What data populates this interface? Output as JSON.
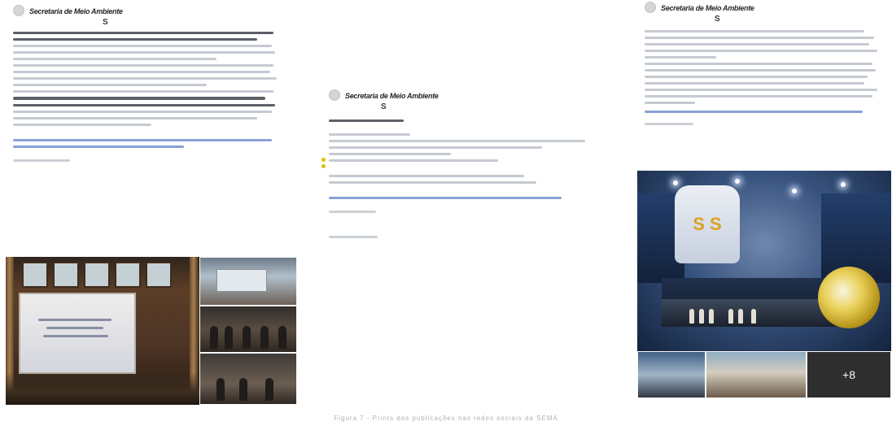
{
  "posts": [
    {
      "author": "Secretaria de Meio Ambiente",
      "glyph": "S"
    },
    {
      "author": "Secretaria de Meio Ambiente",
      "glyph": "S"
    },
    {
      "author": "Secretaria de Meio Ambiente",
      "glyph": "S"
    }
  ],
  "media": {
    "post3_more_count": "+8",
    "post3_sign_text": "S S"
  },
  "caption": "Figura 7 - Prints das publicações nas redes sociais da SEMA"
}
